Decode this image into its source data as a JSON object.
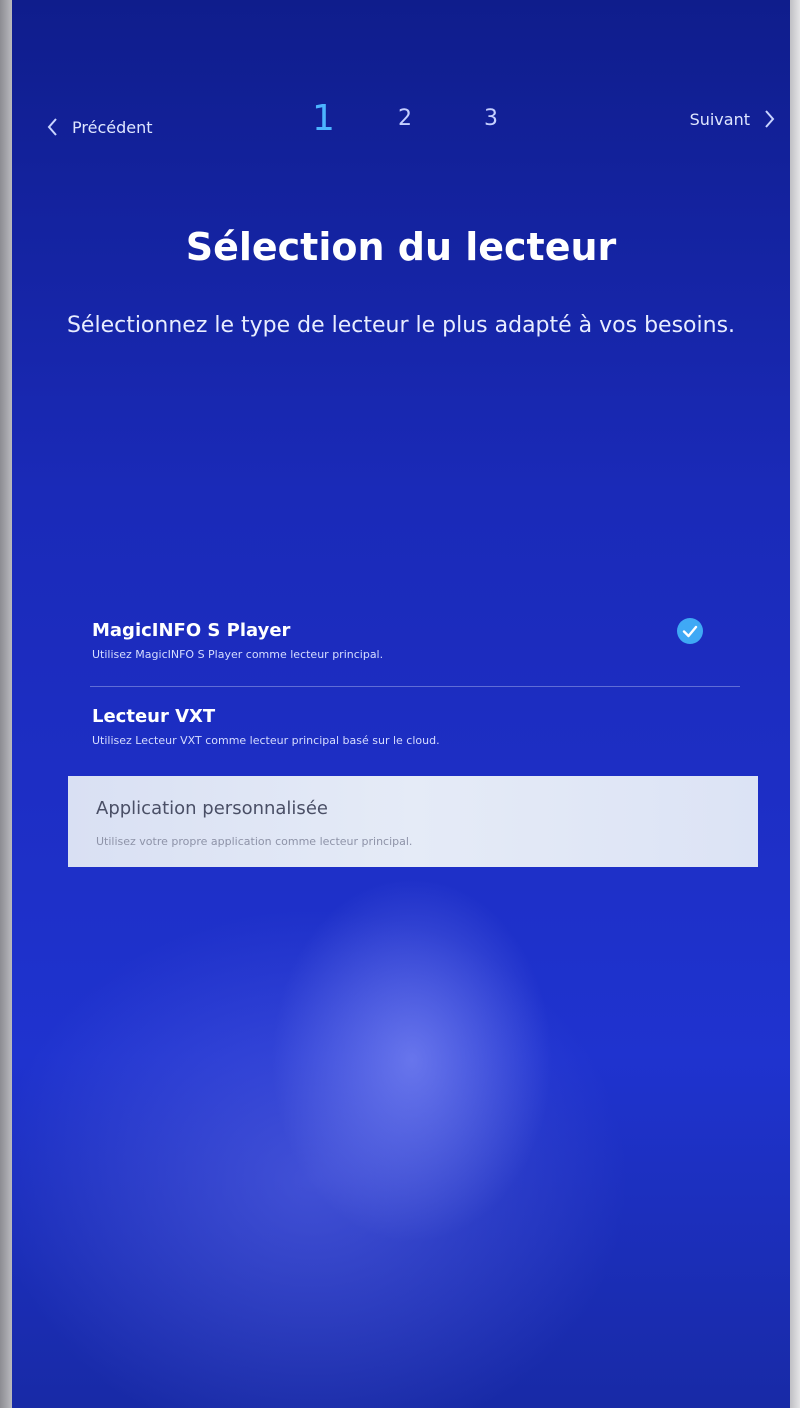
{
  "nav": {
    "prev_label": "Précédent",
    "next_label": "Suivant",
    "steps": [
      "1",
      "2",
      "3"
    ],
    "active_step": "1"
  },
  "header": {
    "title": "Sélection du lecteur",
    "subtitle": "Sélectionnez le type de lecteur le plus adapté à vos besoins."
  },
  "options": [
    {
      "title": "MagicINFO S Player",
      "description": "Utilisez MagicINFO S Player comme lecteur principal.",
      "selected": true
    },
    {
      "title": "Lecteur VXT",
      "description": "Utilisez Lecteur VXT comme lecteur principal basé sur le cloud.",
      "selected": false
    },
    {
      "title": "Application personnalisée",
      "description": "Utilisez votre propre application comme lecteur principal.",
      "selected": false,
      "focused": true
    }
  ],
  "icons": {
    "prev": "chevron-left-icon",
    "next": "chevron-right-icon",
    "selected": "checkmark-circle-icon"
  },
  "colors": {
    "accent": "#4cb4ff",
    "background": "#1d2ec4",
    "focus_bg": "#e0e6f5"
  }
}
